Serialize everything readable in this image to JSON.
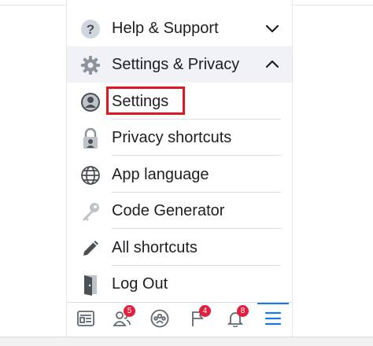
{
  "menu": {
    "help_support": {
      "label": "Help & Support",
      "icon": "question-circle-icon",
      "chevron": "chevron-down-icon"
    },
    "settings_privacy": {
      "label": "Settings & Privacy",
      "icon": "gear-icon",
      "chevron": "chevron-up-icon"
    },
    "items": [
      {
        "label": "Settings",
        "icon": "user-avatar-icon",
        "highlighted": true
      },
      {
        "label": "Privacy shortcuts",
        "icon": "lock-user-icon"
      },
      {
        "label": "App language",
        "icon": "globe-icon"
      },
      {
        "label": "Code Generator",
        "icon": "key-icon"
      },
      {
        "label": "All shortcuts",
        "icon": "pencil-icon"
      },
      {
        "label": "Log Out",
        "icon": "door-icon"
      }
    ]
  },
  "tabbar": {
    "tabs": [
      {
        "name": "news-feed",
        "icon": "news-feed-icon"
      },
      {
        "name": "friends",
        "icon": "friends-icon",
        "badge": "5"
      },
      {
        "name": "groups",
        "icon": "groups-icon"
      },
      {
        "name": "pages",
        "icon": "flag-icon",
        "badge": "4"
      },
      {
        "name": "notifications",
        "icon": "bell-icon",
        "badge": "8"
      },
      {
        "name": "menu",
        "icon": "hamburger-menu-icon",
        "active": true
      }
    ]
  },
  "colors": {
    "highlight_border": "#e0161f",
    "badge": "#e41e3f",
    "accent": "#1877f2",
    "header_bg": "#f0f2f5"
  }
}
